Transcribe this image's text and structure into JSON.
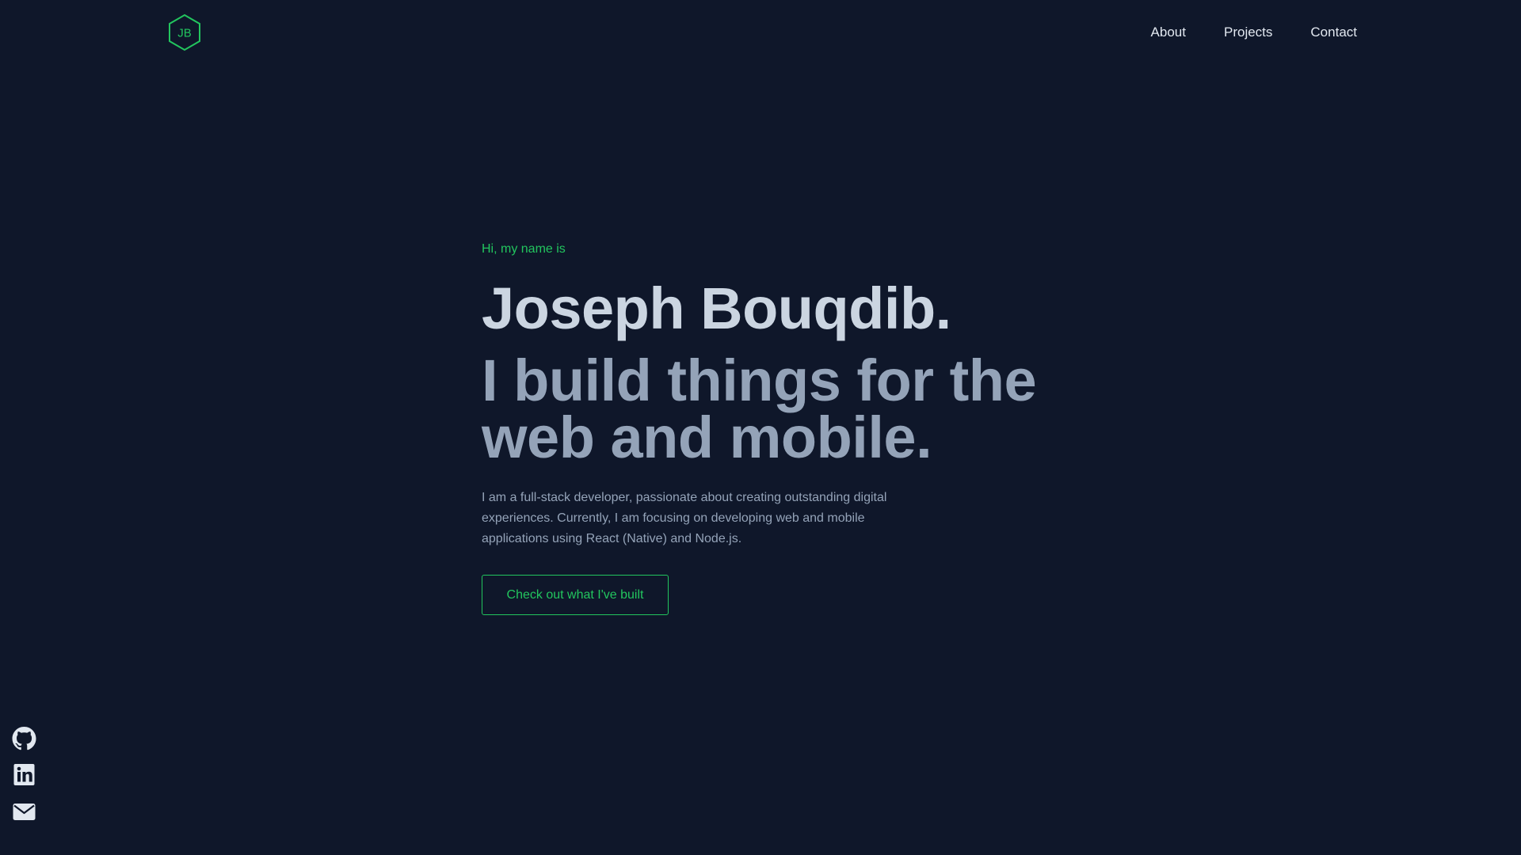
{
  "header": {
    "logo_text": "JB",
    "nav": [
      {
        "label": "About"
      },
      {
        "label": "Projects"
      },
      {
        "label": "Contact"
      }
    ]
  },
  "hero": {
    "greeting": "Hi, my name is",
    "name": "Joseph Bouqdib.",
    "tagline": "I build things for the web and mobile.",
    "bio": "I am a full-stack developer, passionate about creating outstanding digital experiences. Currently, I am focusing on developing web and mobile applications using React (Native) and Node.js.",
    "cta_label": "Check out what I've built"
  },
  "social": {
    "icons": [
      "github-icon",
      "linkedin-icon",
      "email-icon"
    ]
  },
  "colors": {
    "background": "#0f172a",
    "accent": "#22c55e",
    "heading": "#cbd5e1",
    "subheading": "#94a3b8",
    "nav_text": "#e2e8f0",
    "icon": "#e2e8f0"
  }
}
